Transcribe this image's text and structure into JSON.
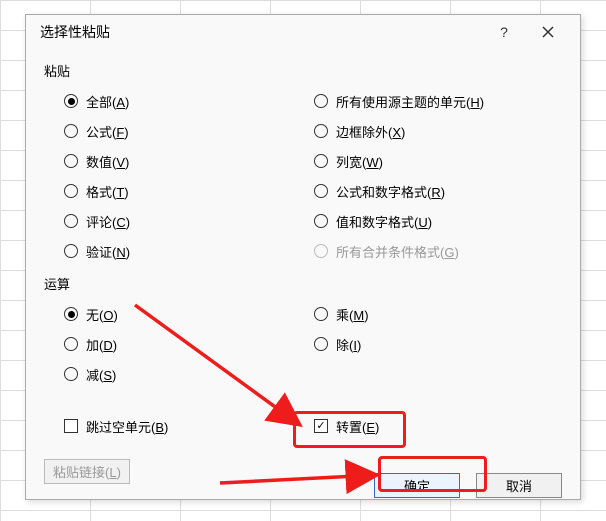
{
  "dialog": {
    "title": "选择性粘贴",
    "help_tooltip": "?",
    "close_tooltip": "×"
  },
  "paste": {
    "label": "粘贴",
    "options": [
      {
        "label": "全部",
        "accel": "A",
        "selected": true,
        "disabled": false
      },
      {
        "label": "所有使用源主题的单元",
        "accel": "H",
        "selected": false,
        "disabled": false
      },
      {
        "label": "公式",
        "accel": "F",
        "selected": false,
        "disabled": false
      },
      {
        "label": "边框除外",
        "accel": "X",
        "selected": false,
        "disabled": false
      },
      {
        "label": "数值",
        "accel": "V",
        "selected": false,
        "disabled": false
      },
      {
        "label": "列宽",
        "accel": "W",
        "selected": false,
        "disabled": false
      },
      {
        "label": "格式",
        "accel": "T",
        "selected": false,
        "disabled": false
      },
      {
        "label": "公式和数字格式",
        "accel": "R",
        "selected": false,
        "disabled": false
      },
      {
        "label": "评论",
        "accel": "C",
        "selected": false,
        "disabled": false
      },
      {
        "label": "值和数字格式",
        "accel": "U",
        "selected": false,
        "disabled": false
      },
      {
        "label": "验证",
        "accel": "N",
        "selected": false,
        "disabled": false
      },
      {
        "label": "所有合并条件格式",
        "accel": "G",
        "selected": false,
        "disabled": true
      }
    ]
  },
  "operation": {
    "label": "运算",
    "options": [
      {
        "label": "无",
        "accel": "O",
        "selected": true
      },
      {
        "label": "乘",
        "accel": "M",
        "selected": false
      },
      {
        "label": "加",
        "accel": "D",
        "selected": false
      },
      {
        "label": "除",
        "accel": "I",
        "selected": false
      },
      {
        "label": "减",
        "accel": "S",
        "selected": false
      }
    ]
  },
  "checks": {
    "skip_blanks": {
      "label": "跳过空单元",
      "accel": "B",
      "checked": false
    },
    "transpose": {
      "label": "转置",
      "accel": "E",
      "checked": true
    }
  },
  "buttons": {
    "paste_link": {
      "label": "粘贴链接",
      "accel": "L",
      "disabled": true
    },
    "ok": "确定",
    "cancel": "取消"
  }
}
